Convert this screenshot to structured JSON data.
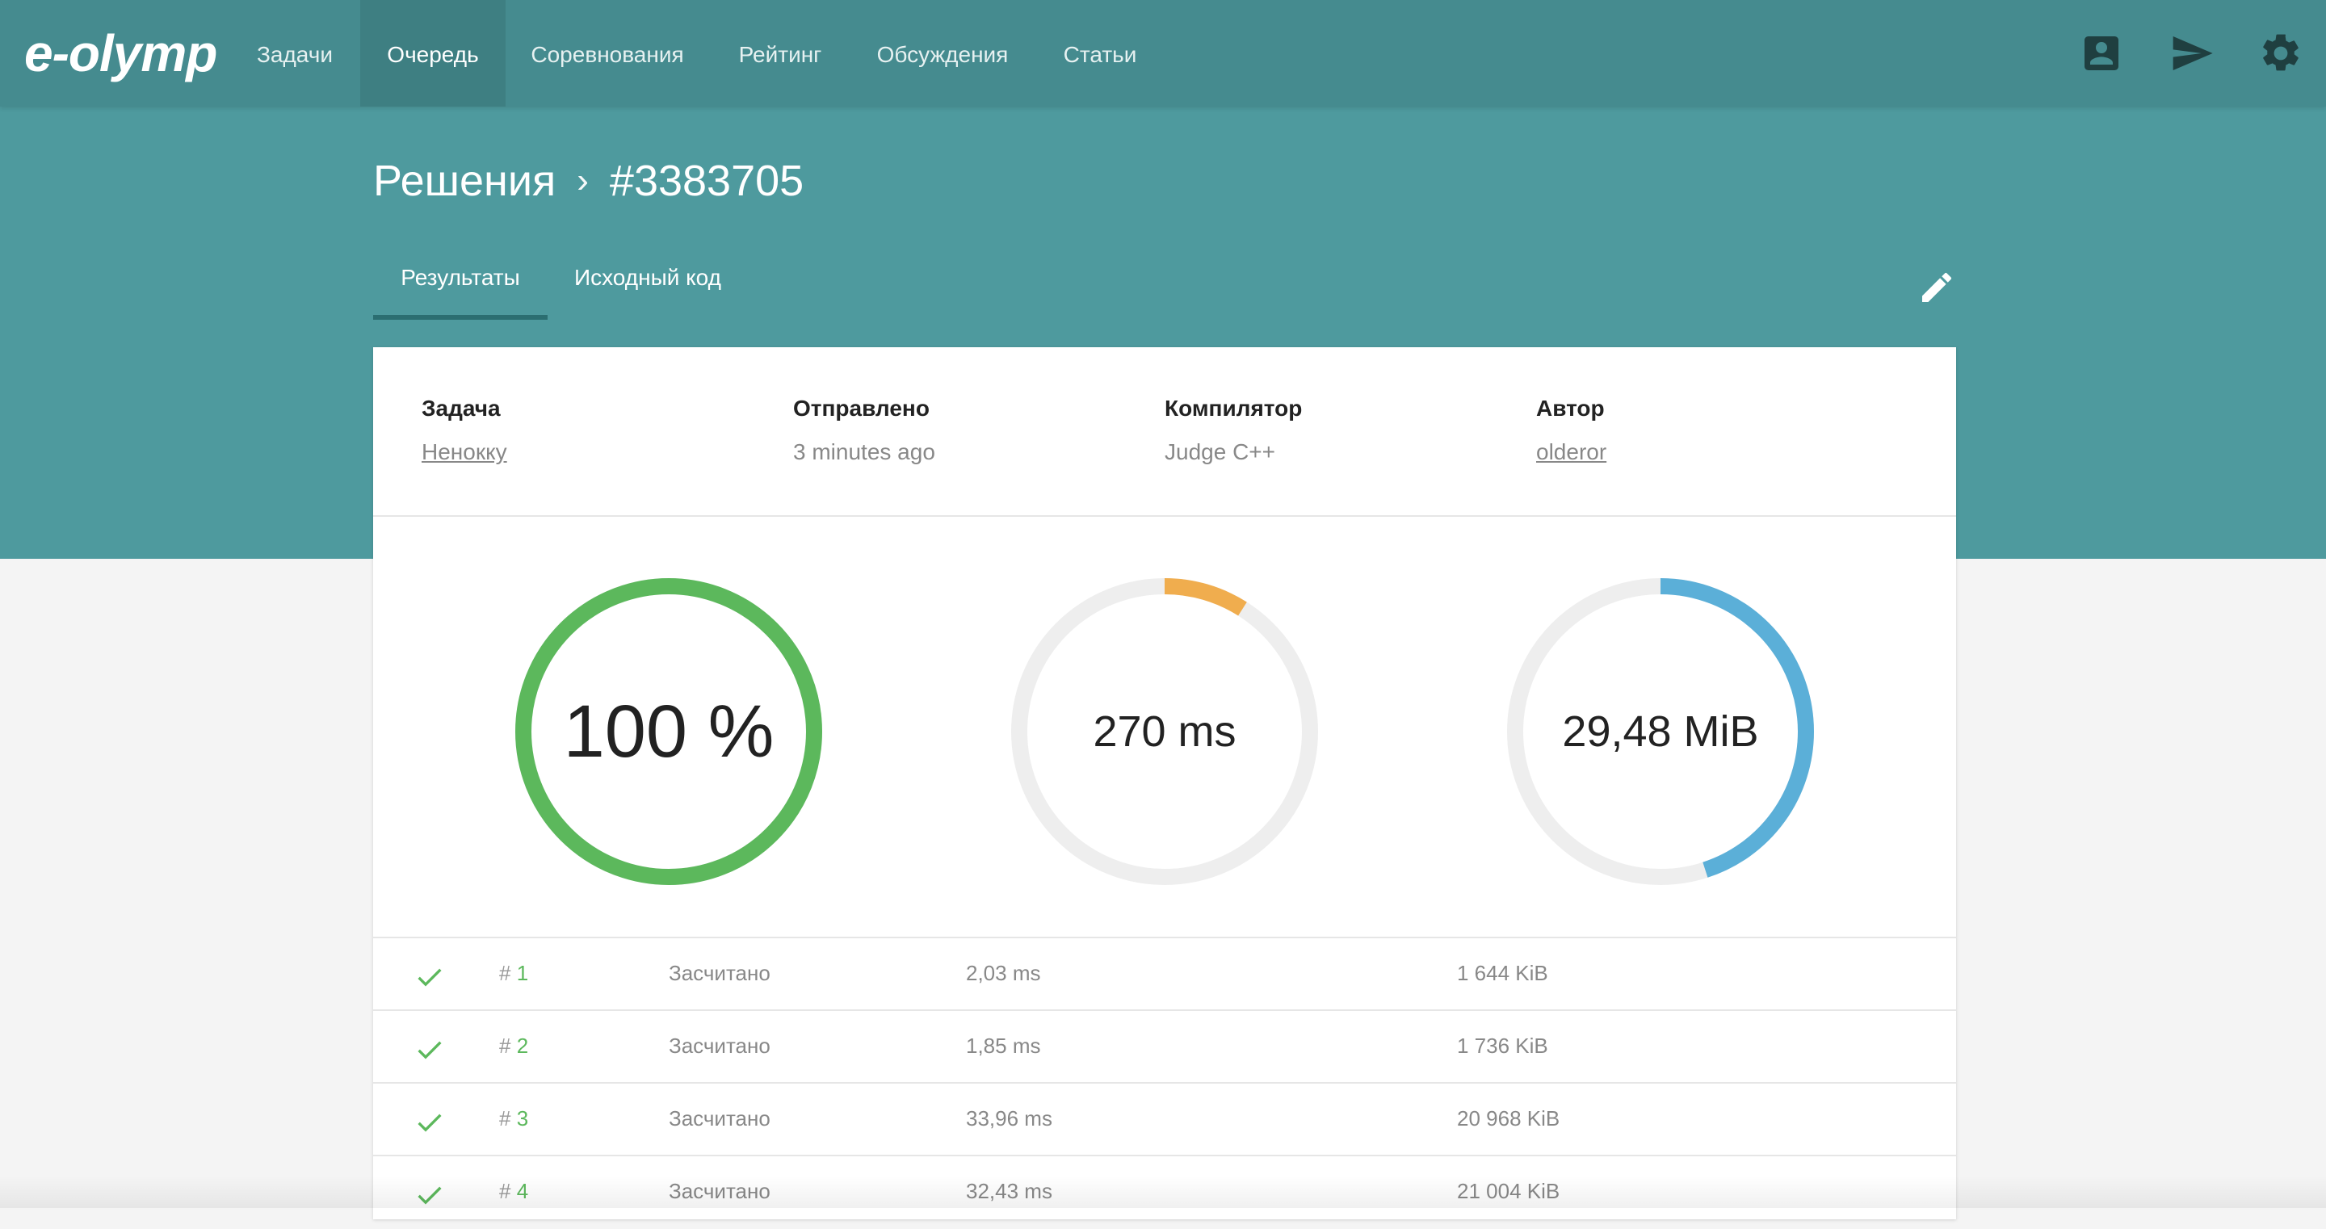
{
  "app": {
    "logo": "e-olymp"
  },
  "nav": {
    "items": [
      {
        "label": "Задачи",
        "active": false
      },
      {
        "label": "Очередь",
        "active": true
      },
      {
        "label": "Соревнования",
        "active": false
      },
      {
        "label": "Рейтинг",
        "active": false
      },
      {
        "label": "Обсуждения",
        "active": false
      },
      {
        "label": "Статьи",
        "active": false
      }
    ],
    "icons": [
      "account-box-icon",
      "send-icon",
      "settings-gear-icon"
    ]
  },
  "breadcrumb": {
    "parent": "Решения",
    "separator": "›",
    "current": "#3383705"
  },
  "tabs": [
    {
      "label": "Результаты",
      "active": true
    },
    {
      "label": "Исходный код",
      "active": false
    }
  ],
  "meta": [
    {
      "label": "Задача",
      "value": "Ненокку",
      "link": true
    },
    {
      "label": "Отправлено",
      "value": "3 minutes ago",
      "link": false
    },
    {
      "label": "Компилятор",
      "value": "Judge C++",
      "link": false
    },
    {
      "label": "Автор",
      "value": "olderor",
      "link": true
    }
  ],
  "gauges": [
    {
      "label": "100 %",
      "fraction": 1.0,
      "color": "#5cb85c"
    },
    {
      "label": "270 ms",
      "fraction": 0.09,
      "color": "#f0ad4e"
    },
    {
      "label": "29,48 MiB",
      "fraction": 0.45,
      "color": "#5bafd8"
    }
  ],
  "tests": [
    {
      "hash": "#",
      "num": "1",
      "status": "Засчитано",
      "time": "2,03 ms",
      "memory": "1 644 KiB"
    },
    {
      "hash": "#",
      "num": "2",
      "status": "Засчитано",
      "time": "1,85 ms",
      "memory": "1 736 KiB"
    },
    {
      "hash": "#",
      "num": "3",
      "status": "Засчитано",
      "time": "33,96 ms",
      "memory": "20 968 KiB"
    },
    {
      "hash": "#",
      "num": "4",
      "status": "Засчитано",
      "time": "32,43 ms",
      "memory": "21 004 KiB"
    }
  ],
  "colors": {
    "teal": "#4e9a9e",
    "navbar": "#458b8f",
    "success": "#5cb85c",
    "track": "#eeeeee"
  }
}
